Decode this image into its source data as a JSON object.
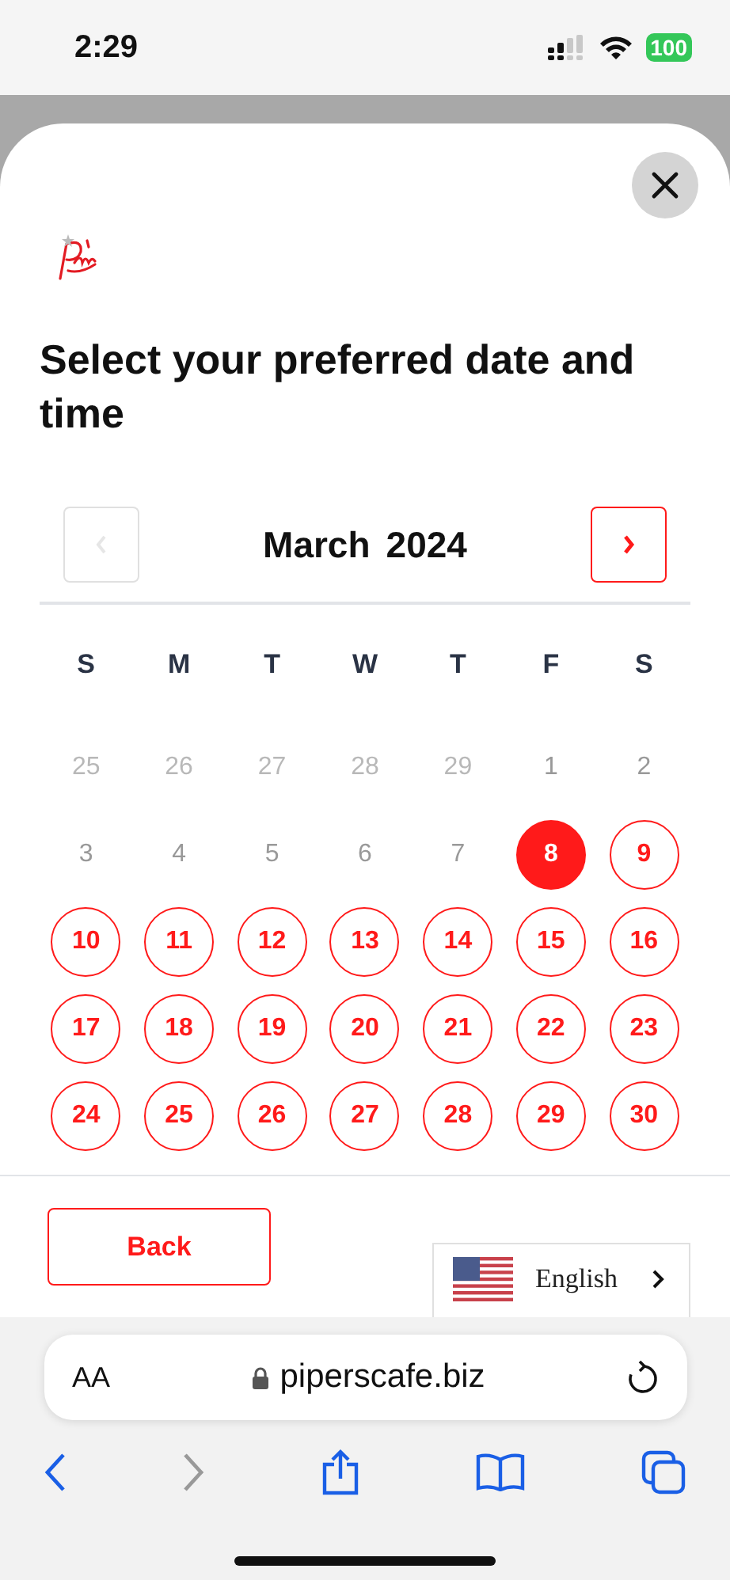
{
  "status_bar": {
    "time": "2:29",
    "battery": "100"
  },
  "heading": "Select your preferred date and time",
  "calendar": {
    "month": "March",
    "year": "2024",
    "prev_disabled": true,
    "next_disabled": false,
    "weekdays": [
      "S",
      "M",
      "T",
      "W",
      "T",
      "F",
      "S"
    ],
    "days": [
      {
        "label": "25",
        "outside_month": true,
        "available": false,
        "selected": false
      },
      {
        "label": "26",
        "outside_month": true,
        "available": false,
        "selected": false
      },
      {
        "label": "27",
        "outside_month": true,
        "available": false,
        "selected": false
      },
      {
        "label": "28",
        "outside_month": true,
        "available": false,
        "selected": false
      },
      {
        "label": "29",
        "outside_month": true,
        "available": false,
        "selected": false
      },
      {
        "label": "1",
        "outside_month": false,
        "available": false,
        "selected": false
      },
      {
        "label": "2",
        "outside_month": false,
        "available": false,
        "selected": false
      },
      {
        "label": "3",
        "outside_month": false,
        "available": false,
        "selected": false
      },
      {
        "label": "4",
        "outside_month": false,
        "available": false,
        "selected": false
      },
      {
        "label": "5",
        "outside_month": false,
        "available": false,
        "selected": false
      },
      {
        "label": "6",
        "outside_month": false,
        "available": false,
        "selected": false
      },
      {
        "label": "7",
        "outside_month": false,
        "available": false,
        "selected": false
      },
      {
        "label": "8",
        "outside_month": false,
        "available": true,
        "selected": true
      },
      {
        "label": "9",
        "outside_month": false,
        "available": true,
        "selected": false
      },
      {
        "label": "10",
        "outside_month": false,
        "available": true,
        "selected": false
      },
      {
        "label": "11",
        "outside_month": false,
        "available": true,
        "selected": false
      },
      {
        "label": "12",
        "outside_month": false,
        "available": true,
        "selected": false
      },
      {
        "label": "13",
        "outside_month": false,
        "available": true,
        "selected": false
      },
      {
        "label": "14",
        "outside_month": false,
        "available": true,
        "selected": false
      },
      {
        "label": "15",
        "outside_month": false,
        "available": true,
        "selected": false
      },
      {
        "label": "16",
        "outside_month": false,
        "available": true,
        "selected": false
      },
      {
        "label": "17",
        "outside_month": false,
        "available": true,
        "selected": false
      },
      {
        "label": "18",
        "outside_month": false,
        "available": true,
        "selected": false
      },
      {
        "label": "19",
        "outside_month": false,
        "available": true,
        "selected": false
      },
      {
        "label": "20",
        "outside_month": false,
        "available": true,
        "selected": false
      },
      {
        "label": "21",
        "outside_month": false,
        "available": true,
        "selected": false
      },
      {
        "label": "22",
        "outside_month": false,
        "available": true,
        "selected": false
      },
      {
        "label": "23",
        "outside_month": false,
        "available": true,
        "selected": false
      },
      {
        "label": "24",
        "outside_month": false,
        "available": true,
        "selected": false
      },
      {
        "label": "25",
        "outside_month": false,
        "available": true,
        "selected": false
      },
      {
        "label": "26",
        "outside_month": false,
        "available": true,
        "selected": false
      },
      {
        "label": "27",
        "outside_month": false,
        "available": true,
        "selected": false
      },
      {
        "label": "28",
        "outside_month": false,
        "available": true,
        "selected": false
      },
      {
        "label": "29",
        "outside_month": false,
        "available": true,
        "selected": false
      },
      {
        "label": "30",
        "outside_month": false,
        "available": true,
        "selected": false
      }
    ]
  },
  "back_button": "Back",
  "language": {
    "label": "English"
  },
  "browser": {
    "text_size": "AA",
    "url": "piperscafe.biz",
    "forward_disabled": true
  }
}
